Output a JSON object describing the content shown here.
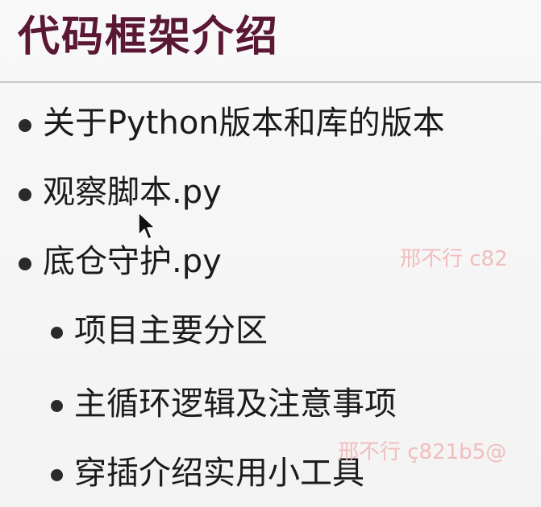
{
  "title": "代码框架介绍",
  "items": [
    {
      "text": "关于Python版本和库的版本",
      "level": 1
    },
    {
      "text": "观察脚本.py",
      "level": 1
    },
    {
      "text": "底仓守护.py",
      "level": 1
    },
    {
      "text": "项目主要分区",
      "level": 2
    },
    {
      "text": "主循环逻辑及注意事项",
      "level": 2
    },
    {
      "text": "穿插介绍实用小工具",
      "level": 2
    }
  ],
  "watermarks": [
    "邢不行 c82",
    "邢不行 ç821b5@"
  ],
  "cursor_icon": "mouse-pointer-icon",
  "colors": {
    "title": "#5a1835",
    "text": "#1b1b1b",
    "watermark": "#f1b0b0"
  }
}
